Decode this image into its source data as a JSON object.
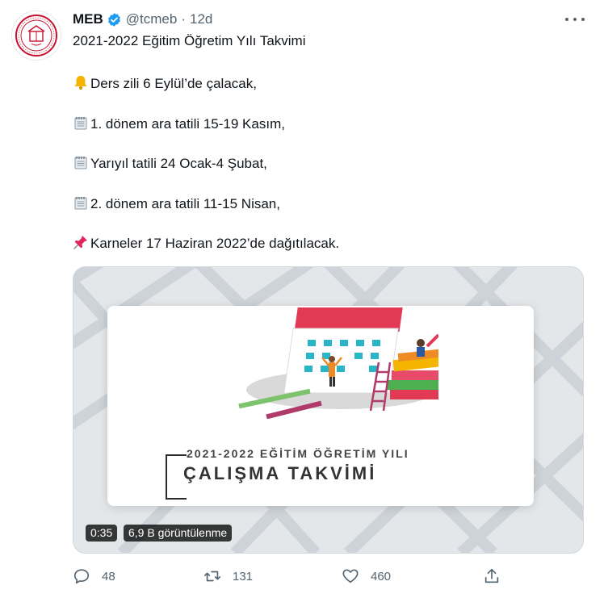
{
  "tweet": {
    "author_name": "MEB",
    "handle": "@tcmeb",
    "separator": "·",
    "time": "12d",
    "title": "2021-2022 Eğitim Öğretim Yılı Takvimi",
    "lines": [
      {
        "icon": "bell-icon",
        "text": "Ders zili 6 Eylül’de çalacak,"
      },
      {
        "icon": "notepad-icon",
        "text": "1. dönem ara tatili 15-19 Kasım,"
      },
      {
        "icon": "notepad-icon",
        "text": "Yarıyıl tatili 24 Ocak-4 Şubat,"
      },
      {
        "icon": "notepad-icon",
        "text": "2. dönem ara tatili 11-15 Nisan,"
      },
      {
        "icon": "pushpin-icon",
        "text": "Karneler 17 Haziran 2022’de dağıtılacak."
      }
    ]
  },
  "media": {
    "card_subtitle": "2021-2022 EĞİTİM ÖĞRETİM YILI",
    "card_title": "ÇALIŞMA TAKVİMİ",
    "duration": "0:35",
    "views": "6,9 B görüntülenme"
  },
  "actions": {
    "reply_count": "48",
    "retweet_count": "131",
    "like_count": "460"
  },
  "colors": {
    "verified": "#1d9bf0",
    "text_secondary": "#536471",
    "calendar_red": "#e23a55"
  }
}
